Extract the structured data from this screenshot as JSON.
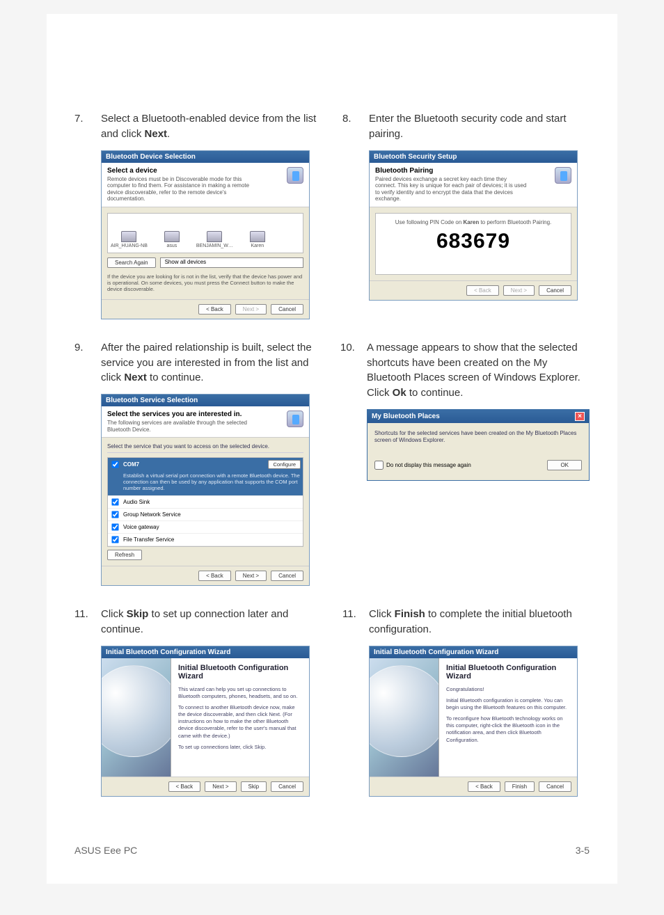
{
  "footer": {
    "left": "ASUS Eee PC",
    "right": "3-5"
  },
  "steps": {
    "s7": {
      "num": "7.",
      "text_a": "Select a Bluetooth-enabled device from the list and click ",
      "bold": "Next",
      "text_b": "."
    },
    "s8": {
      "num": "8.",
      "text_a": "Enter the Bluetooth security code and start pairing.",
      "bold": "",
      "text_b": ""
    },
    "s9": {
      "num": "9.",
      "text_a": "After the paired relationship is built, select the service you are interested in from the list and click ",
      "bold": "Next",
      "text_b": " to continue."
    },
    "s10": {
      "num": "10.",
      "text_a": "A message appears to show that the selected shortcuts have been created on the My Bluetooth Places screen of Windows Explorer. Click ",
      "bold": "Ok",
      "text_b": " to continue."
    },
    "s11a": {
      "num": "11.",
      "text_a": "Click ",
      "bold": "Skip",
      "text_b": " to set up connection later and continue."
    },
    "s11b": {
      "num": "11.",
      "text_a": "Click ",
      "bold": "Finish",
      "text_b": " to complete the initial bluetooth configuration."
    }
  },
  "dlg7": {
    "title": "Bluetooth Device Selection",
    "heading": "Select a device",
    "sub": "Remote devices must be in Discoverable mode for this computer to find them. For assistance in making a remote device discoverable, refer to the remote device's documentation.",
    "devices": [
      "AIR_HUANG-NB",
      "asus",
      "BENJAMIN_W…",
      "Karen"
    ],
    "search": "Search Again",
    "show": "Show all devices",
    "hint": "If the device you are looking for is not in the list, verify that the device has power and is operational. On some devices, you must press the Connect button to make the device discoverable.",
    "back": "< Back",
    "next": "Next >",
    "cancel": "Cancel"
  },
  "dlg8": {
    "title": "Bluetooth Security Setup",
    "heading": "Bluetooth Pairing",
    "sub": "Paired devices exchange a secret key each time they connect. This key is unique for each pair of devices; it is used to verify identity and to encrypt the data that the devices exchange.",
    "msg_a": "Use following PIN Code on ",
    "msg_bold": "Karen",
    "msg_b": " to perform Bluetooth Pairing.",
    "pin": "683679",
    "back": "< Back",
    "next": "Next >",
    "cancel": "Cancel"
  },
  "dlg9": {
    "title": "Bluetooth Service Selection",
    "heading": "Select the services you are interested in.",
    "sub": "The following services are available through the selected Bluetooth Device.",
    "label": "Select the service that you want to access on the selected device.",
    "sel_name": "COM7",
    "sel_desc": "Establish a virtual serial port connection with a remote Bluetooth device. The connection can then be used by any application that supports the COM port number assigned.",
    "configure": "Configure",
    "items": [
      "Audio Sink",
      "Group Network Service",
      "Voice gateway",
      "File Transfer Service"
    ],
    "refresh": "Refresh",
    "back": "< Back",
    "next": "Next >",
    "cancel": "Cancel"
  },
  "dlg10": {
    "title": "My Bluetooth Places",
    "msg": "Shortcuts for the selected services have been created on the My Bluetooth Places screen of Windows Explorer.",
    "chk": "Do not display this message again",
    "ok": "OK"
  },
  "dlg11a": {
    "title": "Initial Bluetooth Configuration Wizard",
    "h": "Initial Bluetooth Configuration Wizard",
    "p1": "This wizard can help you set up connections to Bluetooth computers, phones, headsets, and so on.",
    "p2": "To connect to another Bluetooth device now, make the device discoverable, and then click Next. (For instructions on how to make the other Bluetooth device discoverable, refer to the user's manual that came with the device.)",
    "p3": "To set up connections later, click Skip.",
    "back": "< Back",
    "next": "Next >",
    "skip": "Skip",
    "cancel": "Cancel"
  },
  "dlg11b": {
    "title": "Initial Bluetooth Configuration Wizard",
    "h": "Initial Bluetooth Configuration Wizard",
    "p1": "Congratulations!",
    "p2": "Initial Bluetooth configuration is complete. You can begin using the Bluetooth features on this computer.",
    "p3": "To reconfigure how Bluetooth technology works on this computer, right-click the Bluetooth icon in the notification area, and then click Bluetooth Configuration.",
    "back": "< Back",
    "finish": "Finish",
    "cancel": "Cancel"
  }
}
